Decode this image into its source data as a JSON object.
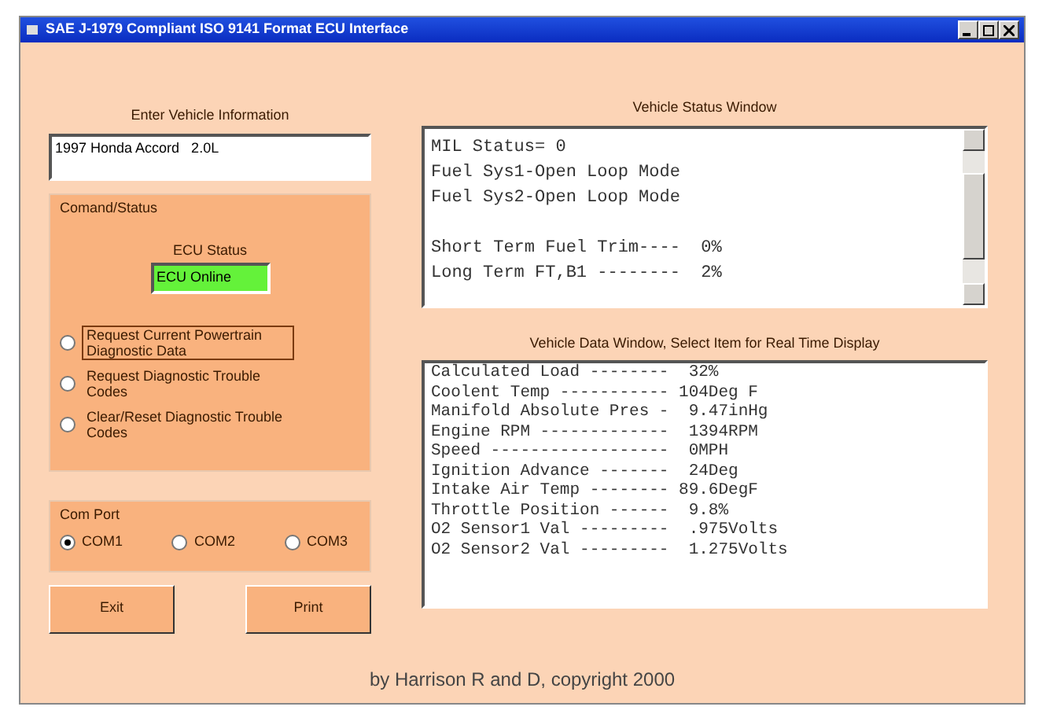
{
  "window": {
    "title": "SAE J-1979 Compliant ISO 9141 Format ECU Interface"
  },
  "vehicle_info": {
    "label": "Enter Vehicle Information",
    "value": "1997 Honda Accord   2.0L"
  },
  "command_status": {
    "title": "Comand/Status",
    "ecu_status_label": "ECU Status",
    "ecu_status": "ECU Online",
    "options": [
      {
        "label": "Request Current Powertrain Diagnostic Data",
        "selected": false,
        "focused": true
      },
      {
        "label": "Request Diagnostic Trouble Codes",
        "selected": false,
        "focused": false
      },
      {
        "label": "Clear/Reset Diagnostic Trouble Codes",
        "selected": false,
        "focused": false
      }
    ]
  },
  "com_port": {
    "title": "Com Port",
    "options": [
      {
        "label": "COM1",
        "selected": true
      },
      {
        "label": "COM2",
        "selected": false
      },
      {
        "label": "COM3",
        "selected": false
      }
    ]
  },
  "buttons": [
    "Exit",
    "Print"
  ],
  "status_window": {
    "label": "Vehicle Status Window",
    "lines": [
      {
        "text": "MIL Status= 0",
        "gap_before": false
      },
      {
        "text": "Fuel Sys1-Open Loop Mode",
        "gap_before": false
      },
      {
        "text": "Fuel Sys2-Open Loop Mode",
        "gap_before": false
      },
      {
        "text": "Short Term Fuel Trim----  0%",
        "gap_before": true
      },
      {
        "text": "Long Term FT,B1 --------  2%",
        "gap_before": false
      }
    ]
  },
  "data_window": {
    "label": "Vehicle Data Window, Select Item for Real Time Display",
    "lines": [
      "Calculated Load --------  32%",
      "Coolent Temp ----------- 104Deg F",
      "Manifold Absolute Pres -  9.47inHg",
      "Engine RPM -------------  1394RPM",
      "Speed ------------------  0MPH",
      "Ignition Advance -------  24Deg",
      "Intake Air Temp -------- 89.6DegF",
      "Throttle Position ------  9.8%",
      "O2 Sensor1 Val ---------  .975Volts",
      "O2 Sensor2 Val ---------  1.275Volts"
    ]
  },
  "footer": "by Harrison R and D, copyright 2000"
}
